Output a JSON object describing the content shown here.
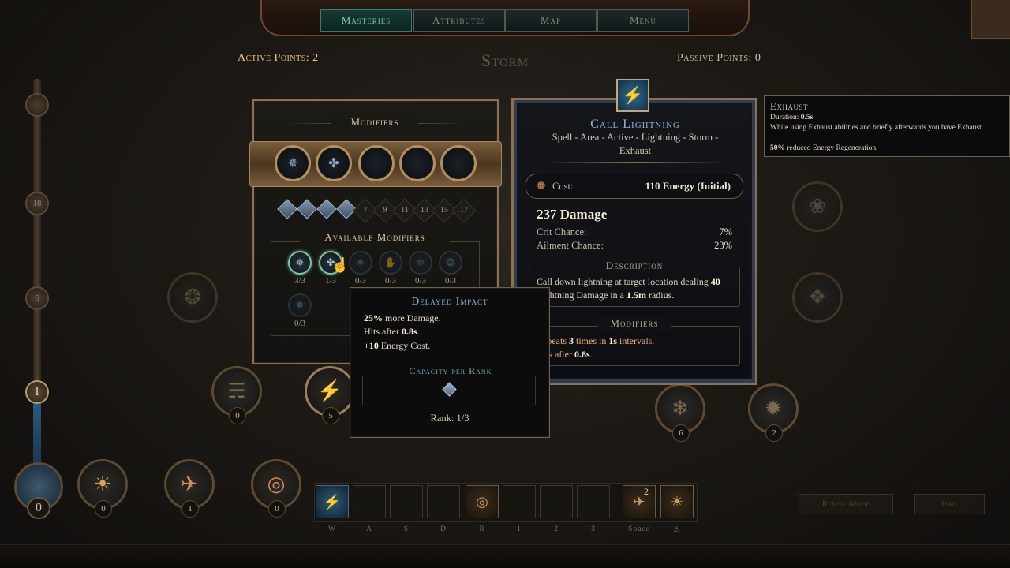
{
  "nav": {
    "tabs": [
      {
        "label": "Masteries",
        "active": true
      },
      {
        "label": "Attributes",
        "active": false
      },
      {
        "label": "Map",
        "active": false
      },
      {
        "label": "Menu",
        "active": false
      }
    ]
  },
  "header": {
    "active_points_label": "Active Points:",
    "active_points_value": "2",
    "tree_title": "Storm",
    "passive_points_label": "Passive Points:",
    "passive_points_value": "0"
  },
  "track": {
    "knobs": [
      "18",
      "6",
      "I"
    ],
    "orb_count": "0"
  },
  "modifiers_panel": {
    "title": "Modifiers",
    "capacity_marks": [
      "7",
      "9",
      "11",
      "13",
      "15",
      "17"
    ],
    "filled_capacity": 4,
    "available_title": "Available Modifiers",
    "available": [
      {
        "icon": "lightning-swirl-icon",
        "rank": "3/3",
        "state": "selected"
      },
      {
        "icon": "delayed-impact-icon",
        "rank": "1/3",
        "state": "selected"
      },
      {
        "icon": "storm-burst-icon",
        "rank": "0/3",
        "state": "locked"
      },
      {
        "icon": "hand-shield-icon",
        "rank": "0/3",
        "state": "locked"
      },
      {
        "icon": "frost-spark-icon",
        "rank": "0/3",
        "state": "locked"
      },
      {
        "icon": "crown-spark-icon",
        "rank": "0/3",
        "state": "locked"
      },
      {
        "icon": "orb-spark-icon",
        "rank": "0/3",
        "state": "locked"
      }
    ]
  },
  "skill": {
    "name": "Call Lightning",
    "tags": "Spell - Area - Active - Lightning - Storm - Exhaust",
    "cost_label": "Cost:",
    "cost_value": "110 Energy (Initial)",
    "damage": "237 Damage",
    "stats": [
      {
        "label": "Crit Chance:",
        "value": "7%"
      },
      {
        "label": "Ailment Chance:",
        "value": "23%"
      }
    ],
    "description_title": "Description",
    "description_pre": "Call down lightning at target location dealing ",
    "description_num1": "40",
    "description_mid": "Lightning Damage in a ",
    "description_num2": "1.5m",
    "description_post": " radius.",
    "modifiers_title": "Modifiers",
    "mod_line1_a": "Repeats ",
    "mod_line1_b": "3",
    "mod_line1_c": " times in ",
    "mod_line1_d": "1s",
    "mod_line1_e": " intervals.",
    "mod_line2_a": "Hits after ",
    "mod_line2_b": "0.8s",
    "mod_line2_c": "."
  },
  "exhaust_tooltip": {
    "title": "Exhaust",
    "duration_label": "Duration: ",
    "duration_value": "0.5s",
    "line2": "While using Exhaust abilities and briefly afterwards you have Exhaust.",
    "line3_value": "50%",
    "line3_text": " reduced Energy Regeneration."
  },
  "delayed_impact_tooltip": {
    "title": "Delayed Impact",
    "line1_value": "25%",
    "line1_text": " more Damage.",
    "line2_text": "Hits after ",
    "line2_value": "0.8s",
    "line2_end": ".",
    "line3_value": "+10",
    "line3_text": " Energy Cost.",
    "capacity_title": "Capacity per Rank",
    "rank_text": "Rank: 1/3"
  },
  "tree_nodes": [
    {
      "num": "0"
    },
    {
      "num": "5"
    },
    {
      "num": "6"
    },
    {
      "num": "2"
    }
  ],
  "bottom_nodes": [
    {
      "num": "0"
    },
    {
      "num": "1"
    },
    {
      "num": "0"
    }
  ],
  "hotbar": {
    "keys": [
      "W",
      "A",
      "S",
      "D",
      "R",
      "1",
      "2",
      "3",
      "Space",
      "⚠"
    ],
    "extra_count": "2"
  },
  "buttons": {
    "respec": "Respec Mode",
    "info": "Info"
  }
}
